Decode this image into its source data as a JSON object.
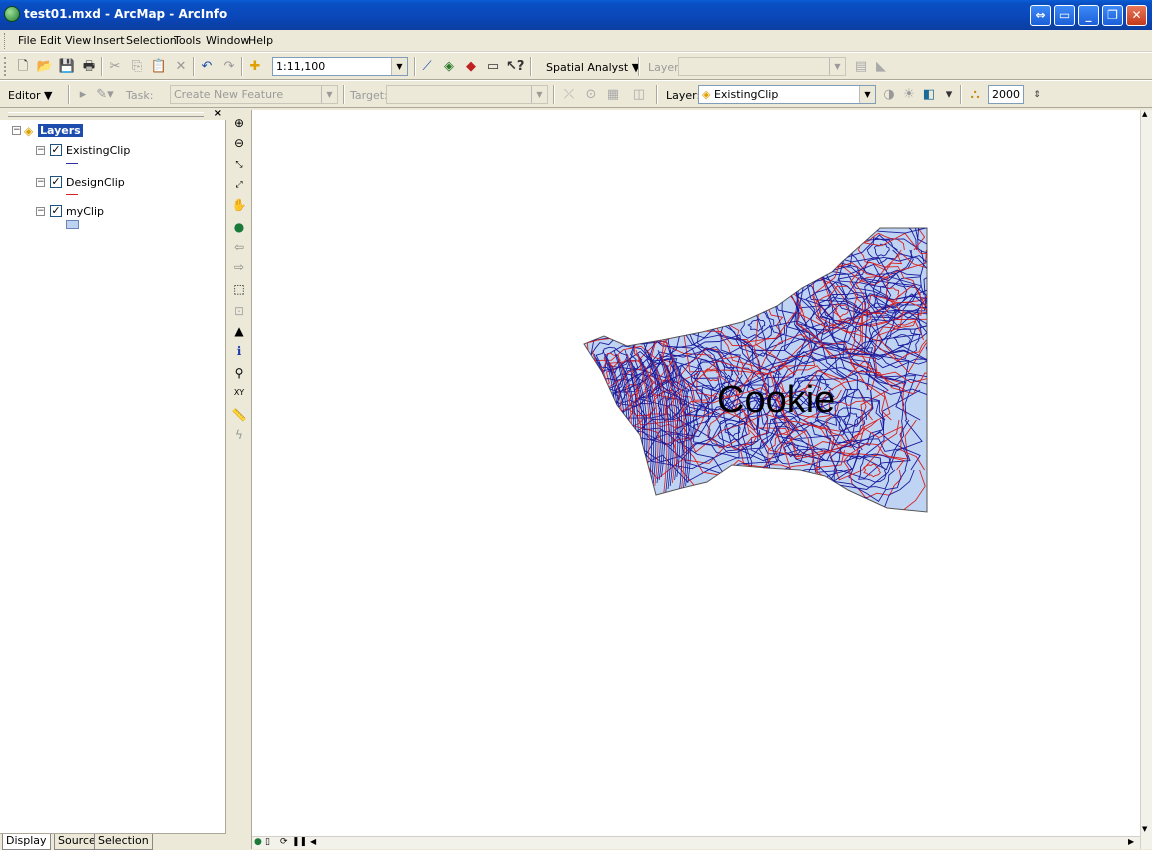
{
  "window": {
    "title": "test01.mxd - ArcMap - ArcInfo"
  },
  "menu": [
    "File",
    "Edit",
    "View",
    "Insert",
    "Selection",
    "Tools",
    "Window",
    "Help"
  ],
  "standard_toolbar": {
    "scale": "1:11,100",
    "spatial_analyst_label": "Spatial Analyst ▼",
    "layer_label": "Layer:",
    "layer_value": ""
  },
  "editor_toolbar": {
    "editor_label": "Editor ▼",
    "task_label": "Task:",
    "task_value": "Create New Feature",
    "target_label": "Target:",
    "target_value": "",
    "layer_label": "Layer:",
    "layer_value": "ExistingClip",
    "snap_value": "2000"
  },
  "toc": {
    "root": "Layers",
    "layers": [
      {
        "name": "ExistingClip",
        "checked": true,
        "symbol_color": "#2f2fa8"
      },
      {
        "name": "DesignClip",
        "checked": true,
        "symbol_color": "#d42020"
      },
      {
        "name": "myClip",
        "checked": true,
        "symbol_color": "#bdd3ef"
      }
    ],
    "tabs": [
      "Display",
      "Source",
      "Selection"
    ]
  },
  "map": {
    "label": "Cookie",
    "fill_color": "#bfd4f2",
    "existing_color": "#1b1b9c",
    "design_color": "#d82020"
  }
}
